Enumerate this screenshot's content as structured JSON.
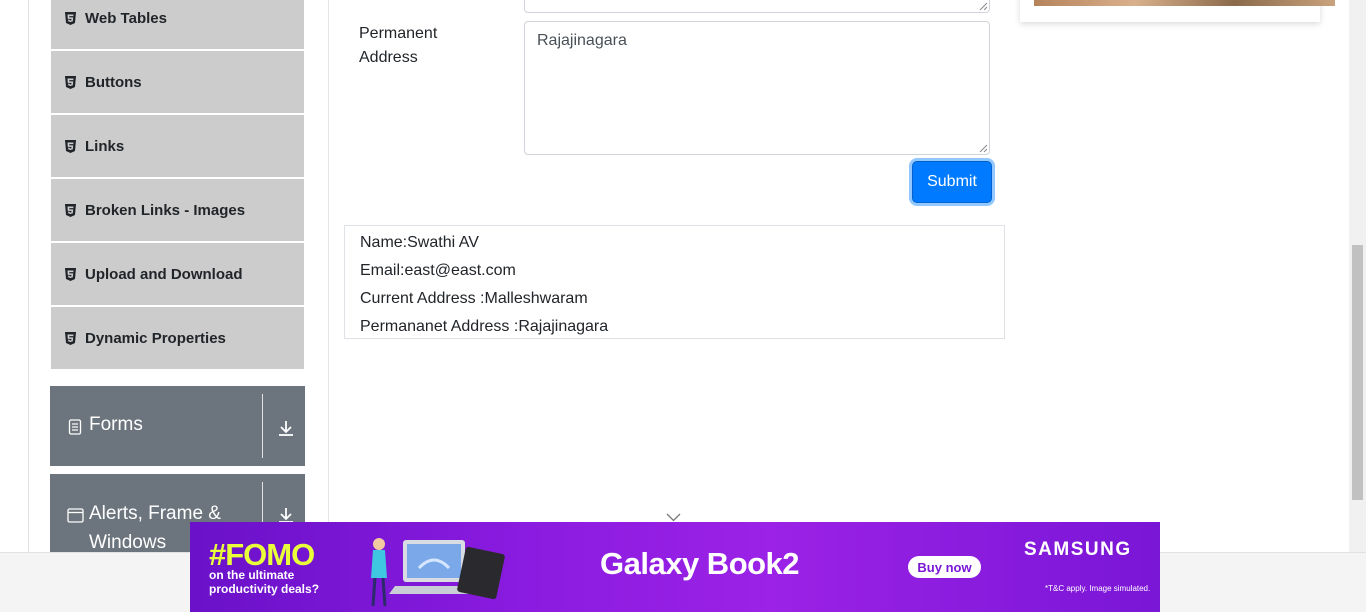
{
  "sidebar": {
    "elements_items": [
      {
        "label": "Web Tables",
        "icon": "html5-icon"
      },
      {
        "label": "Buttons",
        "icon": "html5-icon"
      },
      {
        "label": "Links",
        "icon": "html5-icon"
      },
      {
        "label": "Broken Links - Images",
        "icon": "html5-icon"
      },
      {
        "label": "Upload and Download",
        "icon": "html5-icon"
      },
      {
        "label": "Dynamic Properties",
        "icon": "html5-icon"
      }
    ],
    "groups": [
      {
        "label": "Forms",
        "icon": "document-icon",
        "toggle_icon": "download-arrow-icon"
      },
      {
        "label_line1": "Alerts, Frame &",
        "label_line2": "Windows",
        "icon": "window-icon",
        "toggle_icon": "download-arrow-icon"
      }
    ]
  },
  "form": {
    "permanent_address_label_line1": "Permanent",
    "permanent_address_label_line2": "Address",
    "permanent_address_value": "Rajajinagara",
    "submit_label": "Submit"
  },
  "output": {
    "name": "Name:Swathi AV",
    "email": "Email:east@east.com",
    "current_address": "Current Address :Malleshwaram",
    "permanent_address": "Permananet Address :Rajajinagara"
  },
  "banner": {
    "headline": "#FOMO",
    "subline_1": "on the ultimate",
    "subline_2": "productivity deals?",
    "product": "Galaxy Book2",
    "cta": "Buy now",
    "brand": "SAMSUNG",
    "disclaimer": "*T&C apply. Image simulated."
  },
  "colors": {
    "primary_button": "#007bff",
    "sidebar_item_bg": "#cccccc",
    "group_header_bg": "#6c757d",
    "banner_purple": "#8b1be0",
    "banner_headline": "#e8ff3a"
  }
}
